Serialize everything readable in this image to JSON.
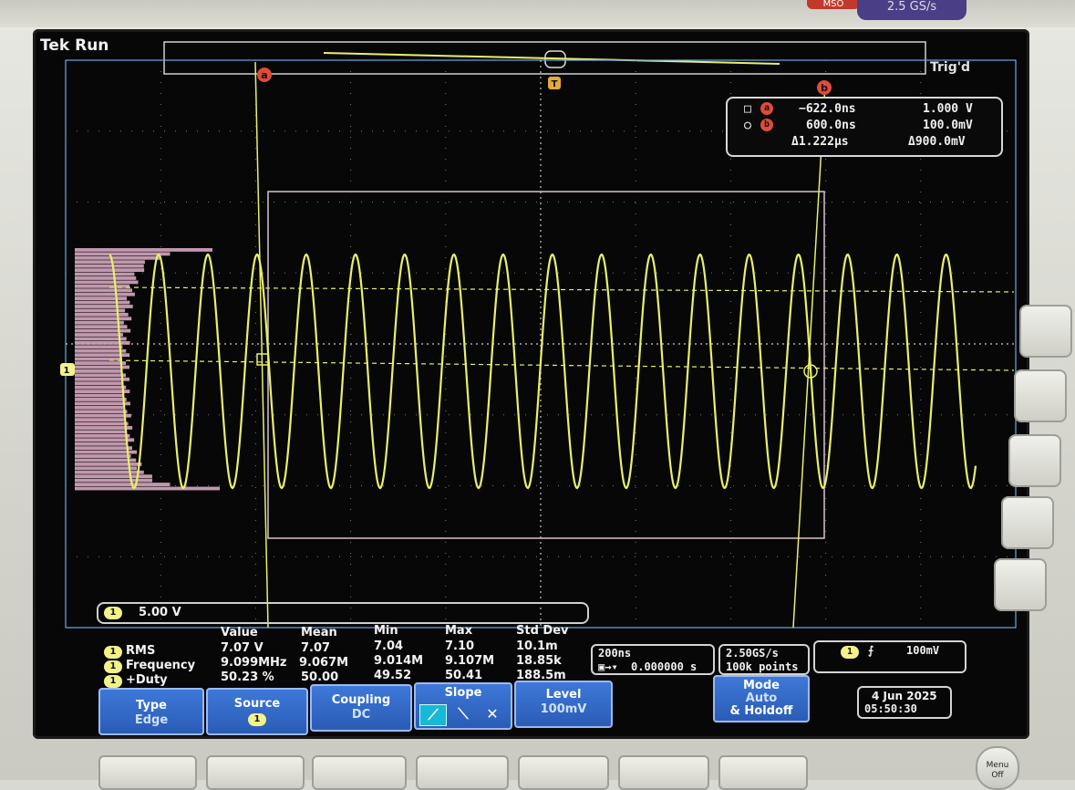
{
  "status": {
    "brand": "Tek",
    "run_state": "Run",
    "trigger_state": "Trig'd"
  },
  "front_panel": {
    "model_badge": "MSO",
    "sample_rate_badge": "2.5 GS/s",
    "menu_off_line1": "Menu",
    "menu_off_line2": "Off"
  },
  "cursors": {
    "marker_a": "a",
    "marker_b": "b",
    "trigger_marker": "T",
    "a": {
      "time": "−622.0ns",
      "value": "1.000 V"
    },
    "b": {
      "time": "600.0ns",
      "value": "100.0mV"
    },
    "delta": {
      "time": "Δ1.222µs",
      "value": "Δ900.0mV"
    }
  },
  "channel": {
    "id": "1",
    "scale": "5.00 V"
  },
  "measurements": {
    "headers": [
      "Value",
      "Mean",
      "Min",
      "Max",
      "Std Dev"
    ],
    "rows": [
      {
        "name": "RMS",
        "value": "7.07 V",
        "mean": "7.07",
        "min": "7.04",
        "max": "7.10",
        "std": "10.1m"
      },
      {
        "name": "Frequency",
        "value": "9.099MHz",
        "mean": "9.067M",
        "min": "9.014M",
        "max": "9.107M",
        "std": "18.85k"
      },
      {
        "name": "+Duty",
        "value": "50.23 %",
        "mean": "50.00",
        "min": "49.52",
        "max": "50.41",
        "std": "188.5m"
      }
    ]
  },
  "timebase": {
    "per_div": "200ns",
    "position": "0.000000 s"
  },
  "acquisition": {
    "rate": "2.50GS/s",
    "points": "100k points"
  },
  "trigger": {
    "source": "1",
    "level": "100mV"
  },
  "date": {
    "day": "4 Jun 2025",
    "time": "05:50:30"
  },
  "softkeys": {
    "type": {
      "label": "Type",
      "value": "Edge"
    },
    "source": {
      "label": "Source",
      "value": "1"
    },
    "coupling": {
      "label": "Coupling",
      "value": "DC"
    },
    "slope": {
      "label": "Slope"
    },
    "level": {
      "label": "Level",
      "value": "100mV"
    },
    "mode": {
      "label": "Mode",
      "value": "Auto",
      "extra": "& Holdoff"
    }
  },
  "colors": {
    "trace": "#e9f06a",
    "histogram": "#d9a9c2",
    "grid": "#8a8a8a",
    "cursor": "#e8f06a",
    "softkey": "#2f66c4",
    "marker": "#e04b3a"
  }
}
